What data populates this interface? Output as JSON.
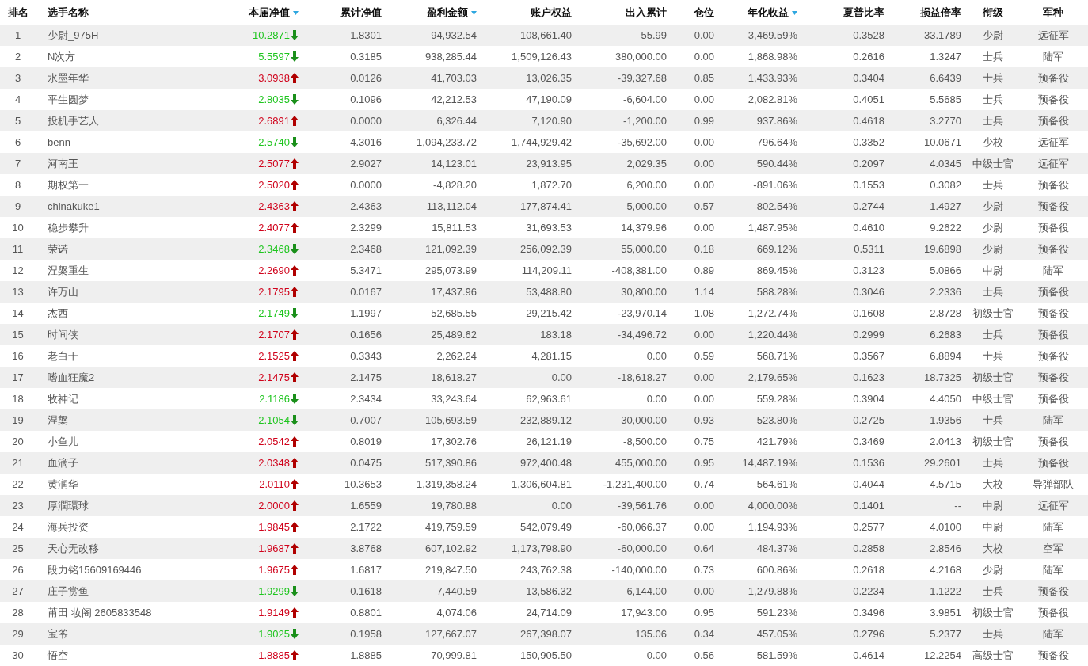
{
  "table": {
    "columns": [
      {
        "label": "排名",
        "sortable": false
      },
      {
        "label": "选手名称",
        "sortable": false
      },
      {
        "label": "本届净值",
        "sortable": true
      },
      {
        "label": "累计净值",
        "sortable": false
      },
      {
        "label": "盈利金额",
        "sortable": true
      },
      {
        "label": "账户权益",
        "sortable": false
      },
      {
        "label": "出入累计",
        "sortable": false
      },
      {
        "label": "仓位",
        "sortable": false
      },
      {
        "label": "年化收益",
        "sortable": true
      },
      {
        "label": "夏普比率",
        "sortable": false
      },
      {
        "label": "损益倍率",
        "sortable": false
      },
      {
        "label": "衔级",
        "sortable": false
      },
      {
        "label": "军种",
        "sortable": false
      }
    ],
    "rows": [
      {
        "cells": [
          "1",
          "少尉_975H",
          "10.2871",
          "1.8301",
          "94,932.54",
          "108,661.40",
          "55.99",
          "0.00",
          "3,469.59%",
          "0.3528",
          "33.1789",
          "少尉",
          "远征军"
        ],
        "up": false
      },
      {
        "cells": [
          "2",
          "N次方",
          "5.5597",
          "0.3185",
          "938,285.44",
          "1,509,126.43",
          "380,000.00",
          "0.00",
          "1,868.98%",
          "0.2616",
          "1.3247",
          "士兵",
          "陆军"
        ],
        "up": false
      },
      {
        "cells": [
          "3",
          "水墨年华",
          "3.0938",
          "0.0126",
          "41,703.03",
          "13,026.35",
          "-39,327.68",
          "0.85",
          "1,433.93%",
          "0.3404",
          "6.6439",
          "士兵",
          "预备役"
        ],
        "up": true
      },
      {
        "cells": [
          "4",
          "平生圆梦",
          "2.8035",
          "0.1096",
          "42,212.53",
          "47,190.09",
          "-6,604.00",
          "0.00",
          "2,082.81%",
          "0.4051",
          "5.5685",
          "士兵",
          "预备役"
        ],
        "up": false
      },
      {
        "cells": [
          "5",
          "投机手艺人",
          "2.6891",
          "0.0000",
          "6,326.44",
          "7,120.90",
          "-1,200.00",
          "0.99",
          "937.86%",
          "0.4618",
          "3.2770",
          "士兵",
          "预备役"
        ],
        "up": true
      },
      {
        "cells": [
          "6",
          "benn",
          "2.5740",
          "4.3016",
          "1,094,233.72",
          "1,744,929.42",
          "-35,692.00",
          "0.00",
          "796.64%",
          "0.3352",
          "10.0671",
          "少校",
          "远征军"
        ],
        "up": false
      },
      {
        "cells": [
          "7",
          "河南王",
          "2.5077",
          "2.9027",
          "14,123.01",
          "23,913.95",
          "2,029.35",
          "0.00",
          "590.44%",
          "0.2097",
          "4.0345",
          "中级士官",
          "远征军"
        ],
        "up": true
      },
      {
        "cells": [
          "8",
          "期权第一",
          "2.5020",
          "0.0000",
          "-4,828.20",
          "1,872.70",
          "6,200.00",
          "0.00",
          "-891.06%",
          "0.1553",
          "0.3082",
          "士兵",
          "预备役"
        ],
        "up": true
      },
      {
        "cells": [
          "9",
          "chinakuke1",
          "2.4363",
          "2.4363",
          "113,112.04",
          "177,874.41",
          "5,000.00",
          "0.57",
          "802.54%",
          "0.2744",
          "1.4927",
          "少尉",
          "预备役"
        ],
        "up": true
      },
      {
        "cells": [
          "10",
          "稳步攀升",
          "2.4077",
          "2.3299",
          "15,811.53",
          "31,693.53",
          "14,379.96",
          "0.00",
          "1,487.95%",
          "0.4610",
          "9.2622",
          "少尉",
          "预备役"
        ],
        "up": true
      },
      {
        "cells": [
          "11",
          "荣诺",
          "2.3468",
          "2.3468",
          "121,092.39",
          "256,092.39",
          "55,000.00",
          "0.18",
          "669.12%",
          "0.5311",
          "19.6898",
          "少尉",
          "预备役"
        ],
        "up": false
      },
      {
        "cells": [
          "12",
          "涅槃重生",
          "2.2690",
          "5.3471",
          "295,073.99",
          "114,209.11",
          "-408,381.00",
          "0.89",
          "869.45%",
          "0.3123",
          "5.0866",
          "中尉",
          "陆军"
        ],
        "up": true
      },
      {
        "cells": [
          "13",
          "许万山",
          "2.1795",
          "0.0167",
          "17,437.96",
          "53,488.80",
          "30,800.00",
          "1.14",
          "588.28%",
          "0.3046",
          "2.2336",
          "士兵",
          "预备役"
        ],
        "up": true
      },
      {
        "cells": [
          "14",
          "杰西",
          "2.1749",
          "1.1997",
          "52,685.55",
          "29,215.42",
          "-23,970.14",
          "1.08",
          "1,272.74%",
          "0.1608",
          "2.8728",
          "初级士官",
          "预备役"
        ],
        "up": false
      },
      {
        "cells": [
          "15",
          "时间侠",
          "2.1707",
          "0.1656",
          "25,489.62",
          "183.18",
          "-34,496.72",
          "0.00",
          "1,220.44%",
          "0.2999",
          "6.2683",
          "士兵",
          "预备役"
        ],
        "up": true
      },
      {
        "cells": [
          "16",
          "老白干",
          "2.1525",
          "0.3343",
          "2,262.24",
          "4,281.15",
          "0.00",
          "0.59",
          "568.71%",
          "0.3567",
          "6.8894",
          "士兵",
          "预备役"
        ],
        "up": true
      },
      {
        "cells": [
          "17",
          "嗜血狂魔2",
          "2.1475",
          "2.1475",
          "18,618.27",
          "0.00",
          "-18,618.27",
          "0.00",
          "2,179.65%",
          "0.1623",
          "18.7325",
          "初级士官",
          "预备役"
        ],
        "up": true
      },
      {
        "cells": [
          "18",
          "牧神记",
          "2.1186",
          "2.3434",
          "33,243.64",
          "62,963.61",
          "0.00",
          "0.00",
          "559.28%",
          "0.3904",
          "4.4050",
          "中级士官",
          "预备役"
        ],
        "up": false
      },
      {
        "cells": [
          "19",
          "涅槃",
          "2.1054",
          "0.7007",
          "105,693.59",
          "232,889.12",
          "30,000.00",
          "0.93",
          "523.80%",
          "0.2725",
          "1.9356",
          "士兵",
          "陆军"
        ],
        "up": false
      },
      {
        "cells": [
          "20",
          "小鱼儿",
          "2.0542",
          "0.8019",
          "17,302.76",
          "26,121.19",
          "-8,500.00",
          "0.75",
          "421.79%",
          "0.3469",
          "2.0413",
          "初级士官",
          "预备役"
        ],
        "up": true
      },
      {
        "cells": [
          "21",
          "血滴子",
          "2.0348",
          "0.0475",
          "517,390.86",
          "972,400.48",
          "455,000.00",
          "0.95",
          "14,487.19%",
          "0.1536",
          "29.2601",
          "士兵",
          "预备役"
        ],
        "up": true
      },
      {
        "cells": [
          "22",
          "黄润华",
          "2.0110",
          "10.3653",
          "1,319,358.24",
          "1,306,604.81",
          "-1,231,400.00",
          "0.74",
          "564.61%",
          "0.4044",
          "4.5715",
          "大校",
          "导弹部队"
        ],
        "up": true
      },
      {
        "cells": [
          "23",
          "厚潤環球",
          "2.0000",
          "1.6559",
          "19,780.88",
          "0.00",
          "-39,561.76",
          "0.00",
          "4,000.00%",
          "0.1401",
          "--",
          "中尉",
          "远征军"
        ],
        "up": true
      },
      {
        "cells": [
          "24",
          "海兵投资",
          "1.9845",
          "2.1722",
          "419,759.59",
          "542,079.49",
          "-60,066.37",
          "0.00",
          "1,194.93%",
          "0.2577",
          "4.0100",
          "中尉",
          "陆军"
        ],
        "up": true
      },
      {
        "cells": [
          "25",
          "天心无改移",
          "1.9687",
          "3.8768",
          "607,102.92",
          "1,173,798.90",
          "-60,000.00",
          "0.64",
          "484.37%",
          "0.2858",
          "2.8546",
          "大校",
          "空军"
        ],
        "up": true
      },
      {
        "cells": [
          "26",
          "段力铭15609169446",
          "1.9675",
          "1.6817",
          "219,847.50",
          "243,762.38",
          "-140,000.00",
          "0.73",
          "600.86%",
          "0.2618",
          "4.2168",
          "少尉",
          "陆军"
        ],
        "up": true
      },
      {
        "cells": [
          "27",
          "庄子赏鱼",
          "1.9299",
          "0.1618",
          "7,440.59",
          "13,586.32",
          "6,144.00",
          "0.00",
          "1,279.88%",
          "0.2234",
          "1.1222",
          "士兵",
          "预备役"
        ],
        "up": false
      },
      {
        "cells": [
          "28",
          "莆田 妆阁 2605833548",
          "1.9149",
          "0.8801",
          "4,074.06",
          "24,714.09",
          "17,943.00",
          "0.95",
          "591.23%",
          "0.3496",
          "3.9851",
          "初级士官",
          "预备役"
        ],
        "up": true
      },
      {
        "cells": [
          "29",
          "宝爷",
          "1.9025",
          "0.1958",
          "127,667.07",
          "267,398.07",
          "135.06",
          "0.34",
          "457.05%",
          "0.2796",
          "5.2377",
          "士兵",
          "陆军"
        ],
        "up": false
      },
      {
        "cells": [
          "30",
          "悟空",
          "1.8885",
          "1.8885",
          "70,999.81",
          "150,905.50",
          "0.00",
          "0.56",
          "581.59%",
          "0.4614",
          "12.2254",
          "高级士官",
          "预备役"
        ],
        "up": true
      }
    ]
  }
}
